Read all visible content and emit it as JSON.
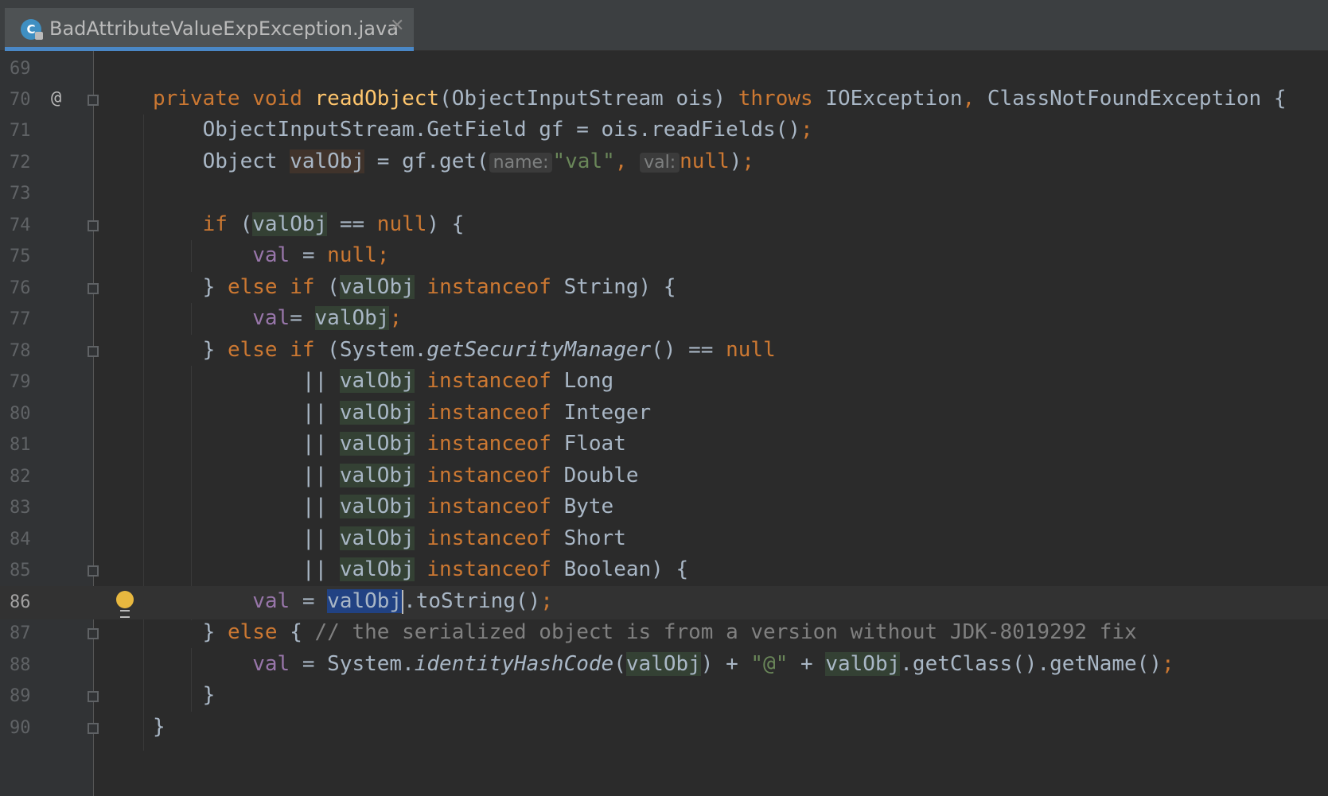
{
  "tab": {
    "icon_letter": "C",
    "filename": "BadAttributeValueExpException.java",
    "close": "✕"
  },
  "gutter": {
    "annotation_symbol": "@",
    "line_numbers": [
      "69",
      "70",
      "71",
      "72",
      "73",
      "74",
      "75",
      "76",
      "77",
      "78",
      "79",
      "80",
      "81",
      "82",
      "83",
      "84",
      "85",
      "86",
      "87",
      "88",
      "89",
      "90"
    ]
  },
  "code": {
    "l70": {
      "private": "private",
      "void": "void",
      "name": "readObject",
      "params": "(ObjectInputStream ois) ",
      "throws": "throws",
      "exc1": " IOException",
      "comma": ",",
      "exc2": " ClassNotFoundException {"
    },
    "l71": {
      "text": "ObjectInputStream.GetField gf = ois.readFields()",
      "semi": ";"
    },
    "l72": {
      "pre": "Object ",
      "var": "valObj",
      "mid": " = gf.get(",
      "hint1": "name:",
      "str": "\"val\"",
      "comma": ", ",
      "hint2": "val:",
      "null": "null",
      ")": ")",
      "semi": ";"
    },
    "l74": {
      "if": "if",
      "open": " (",
      "var": "valObj",
      "eq": " == ",
      "null": "null",
      "close": ") {"
    },
    "l75": {
      "val": "val",
      "eq": " = ",
      "null": "null",
      "semi": ";"
    },
    "l76": {
      "brace": "} ",
      "else": "else",
      "if": " if",
      "open": " (",
      "var": "valObj",
      "sp": " ",
      "inst": "instanceof",
      "type": " String) {"
    },
    "l77": {
      "val": "val",
      "eq": "= ",
      "var": "valObj",
      "semi": ";"
    },
    "l78": {
      "brace": "} ",
      "else": "else",
      "if": " if",
      "open": " (System.",
      "method": "getSecurityManager",
      "rest": "() == ",
      "null": "null"
    },
    "or_lines": [
      {
        "or": "|| ",
        "var": "valObj",
        "sp": " ",
        "inst": "instanceof",
        "type": " Long"
      },
      {
        "or": "|| ",
        "var": "valObj",
        "sp": " ",
        "inst": "instanceof",
        "type": " Integer"
      },
      {
        "or": "|| ",
        "var": "valObj",
        "sp": " ",
        "inst": "instanceof",
        "type": " Float"
      },
      {
        "or": "|| ",
        "var": "valObj",
        "sp": " ",
        "inst": "instanceof",
        "type": " Double"
      },
      {
        "or": "|| ",
        "var": "valObj",
        "sp": " ",
        "inst": "instanceof",
        "type": " Byte"
      },
      {
        "or": "|| ",
        "var": "valObj",
        "sp": " ",
        "inst": "instanceof",
        "type": " Short"
      },
      {
        "or": "|| ",
        "var": "valObj",
        "sp": " ",
        "inst": "instanceof",
        "type": " Boolean) {"
      }
    ],
    "l86": {
      "val": "val",
      "eq": " = ",
      "var": "valObj",
      "rest": ".toString()",
      "semi": ";"
    },
    "l87": {
      "brace": "} ",
      "else": "else",
      "open": " { ",
      "comment": "// the serialized object is from a version without JDK-8019292 fix"
    },
    "l88": {
      "val": "val",
      "eq": " = System.",
      "method": "identityHashCode",
      "open": "(",
      "var1": "valObj",
      "mid": ") + ",
      "str": "\"@\"",
      "plus": " + ",
      "var2": "valObj",
      "rest": ".getClass().getName()",
      "semi": ";"
    },
    "l89": {
      "brace": "}"
    },
    "l90": {
      "brace": "}"
    }
  }
}
